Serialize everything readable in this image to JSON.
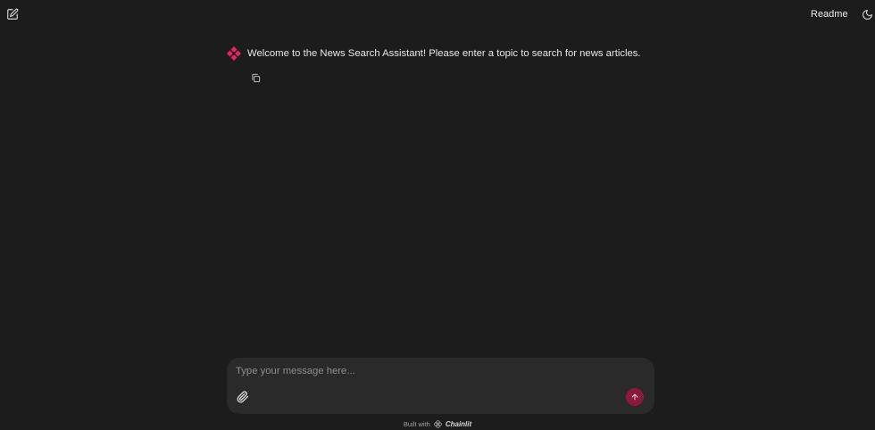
{
  "header": {
    "readme_label": "Readme",
    "new_chat_icon": "edit-square-icon",
    "theme_icon": "moon-icon"
  },
  "message": {
    "avatar_icon": "chainlit-logo-icon",
    "text": "Welcome to the News Search Assistant! Please enter a topic to search for news articles.",
    "copy_icon": "copy-icon"
  },
  "composer": {
    "placeholder": "Type your message here...",
    "value": "",
    "attach_icon": "paperclip-icon",
    "send_icon": "arrow-up-icon"
  },
  "footer": {
    "built_with": "Built with",
    "brand": "Chainlit"
  },
  "colors": {
    "background": "#1c1c1c",
    "composer_bg": "#2a2a2a",
    "accent": "#e8245c",
    "send_button": "#8a1a3c"
  }
}
